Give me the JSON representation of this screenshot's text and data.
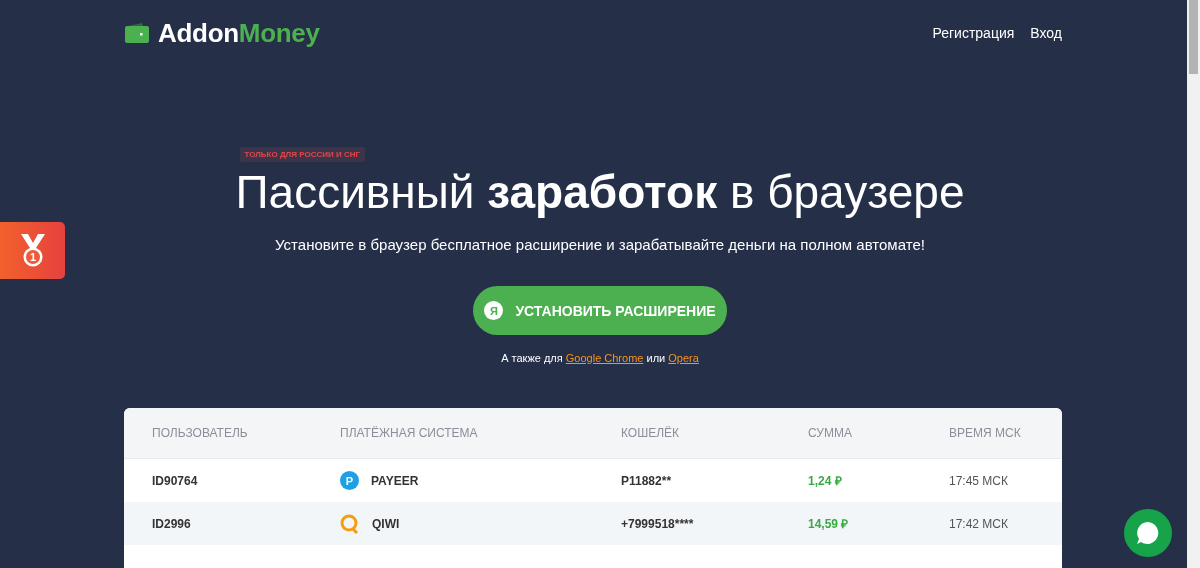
{
  "header": {
    "logo": {
      "part_1": "Addon",
      "part_2": "Money"
    },
    "nav": [
      "Регистрация",
      "Вход"
    ]
  },
  "side_tab": {
    "medal_digit": "1"
  },
  "hero": {
    "badge": "ТОЛЬКО ДЛЯ РОССИИ И СНГ",
    "title": "Пассивный **заработок** в браузере",
    "subtitle": "Установите в браузер бесплатное расширение и зарабатывайте деньги на полном автомате!",
    "install_button": {
      "icon_letter": "Я",
      "label": "УСТАНОВИТЬ РАСШИРЕНИЕ"
    },
    "also_line": {
      "prefix": "А также для",
      "links": [
        "Google Chrome",
        "Opera"
      ],
      "joiner": "или"
    }
  },
  "table": {
    "columns": [
      "ПОЛЬЗОВАТЕЛЬ",
      "ПЛАТЁЖНАЯ СИСТЕМА",
      "КОШЕЛЁК",
      "СУММА",
      "ВРЕМЯ МСК"
    ],
    "rows": [
      {
        "user": "ID90764",
        "system": {
          "kind": "payeer",
          "icon_letter": "P",
          "name": "PAYEER"
        },
        "wallet": "P11882**",
        "amount": "1,24 ₽",
        "time": "17:45 МСК"
      },
      {
        "user": "ID2996",
        "system": {
          "kind": "qiwi",
          "name": "QIWI"
        },
        "wallet": "+7999518****",
        "amount": "14,59 ₽",
        "time": "17:42 МСК"
      }
    ]
  }
}
